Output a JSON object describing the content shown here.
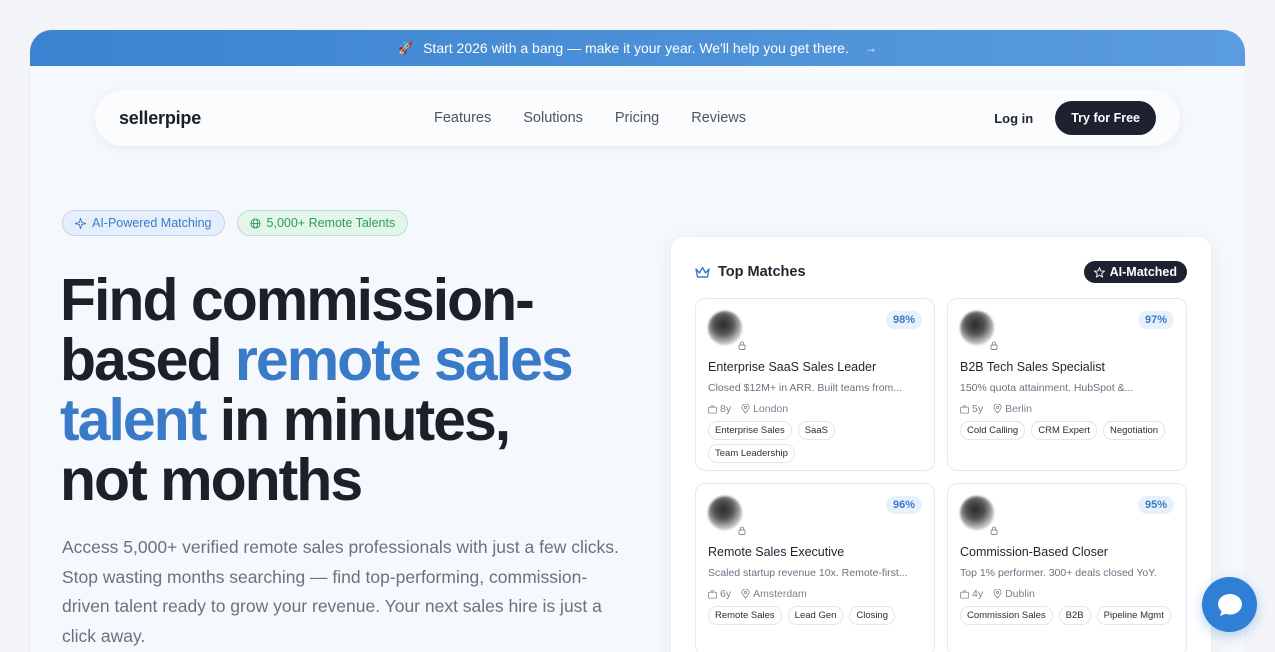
{
  "banner": {
    "text": "Start 2026 with a bang — make it your year. We'll help you get there.",
    "icon": "rocket-icon",
    "arrow": "→"
  },
  "nav": {
    "logo": "sellerpipe",
    "links": [
      "Features",
      "Solutions",
      "Pricing",
      "Reviews"
    ],
    "login": "Log in",
    "cta": "Try for Free"
  },
  "hero": {
    "badges": [
      "AI-Powered Matching",
      "5,000+ Remote Talents"
    ],
    "headline_1": "Find commission-",
    "headline_2a": "based ",
    "headline_2b": "remote sales",
    "headline_3a": "talent",
    "headline_3b": " in minutes,",
    "headline_4": "not months",
    "subtext": "Access 5,000+ verified remote sales professionals with just a few clicks. Stop wasting months searching — find top-performing, commission-driven talent ready to grow your revenue. Your next sales hire is just a click away."
  },
  "panel": {
    "title": "Top Matches",
    "badge": "AI-Matched",
    "cards": [
      {
        "pct": "98%",
        "title": "Enterprise SaaS Sales Leader",
        "desc": "Closed $12M+ in ARR. Built teams from...",
        "years": "8y",
        "location": "London",
        "tags": [
          "Enterprise Sales",
          "SaaS",
          "Team Leadership"
        ]
      },
      {
        "pct": "97%",
        "title": "B2B Tech Sales Specialist",
        "desc": "150% quota attainment. HubSpot &...",
        "years": "5y",
        "location": "Berlin",
        "tags": [
          "Cold Calling",
          "CRM Expert",
          "Negotiation"
        ]
      },
      {
        "pct": "96%",
        "title": "Remote Sales Executive",
        "desc": "Scaled startup revenue 10x. Remote-first...",
        "years": "6y",
        "location": "Amsterdam",
        "tags": [
          "Remote Sales",
          "Lead Gen",
          "Closing"
        ]
      },
      {
        "pct": "95%",
        "title": "Commission-Based Closer",
        "desc": "Top 1% performer. 300+ deals closed YoY.",
        "years": "4y",
        "location": "Dublin",
        "tags": [
          "Commission Sales",
          "B2B",
          "Pipeline Mgmt"
        ]
      }
    ]
  },
  "colors": {
    "accent": "#3a7bc8",
    "dark": "#1e2230",
    "chat": "#2f7fd6"
  }
}
